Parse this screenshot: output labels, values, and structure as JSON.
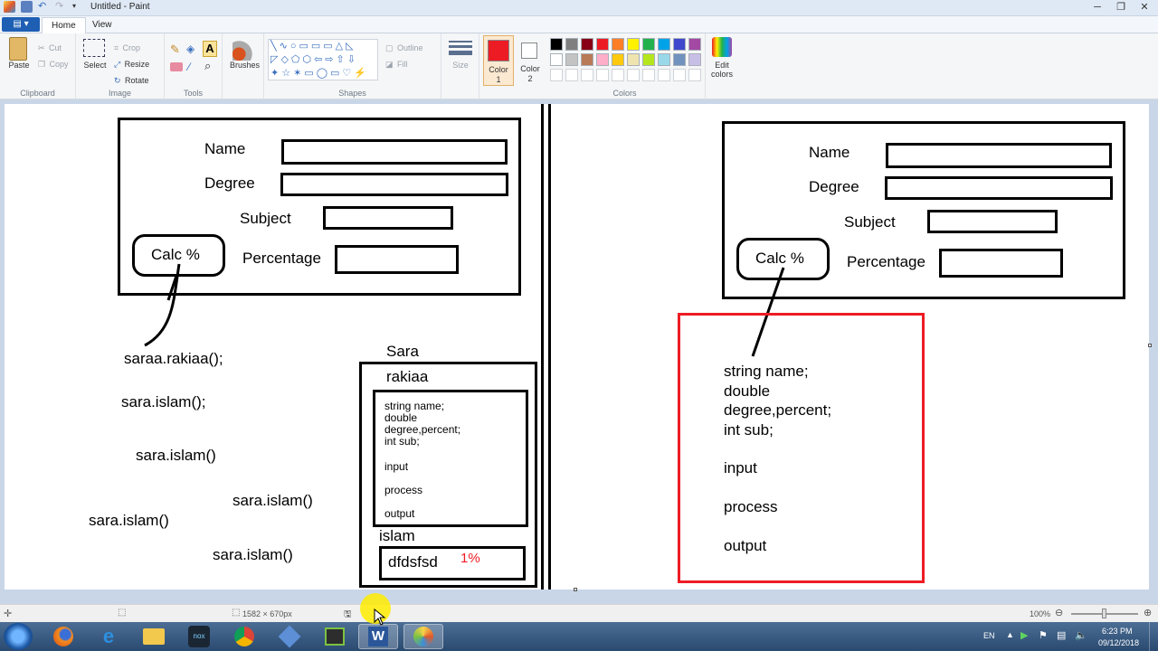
{
  "window": {
    "title": "Untitled - Paint"
  },
  "tabs": {
    "file": "▤ ▾",
    "home": "Home",
    "view": "View"
  },
  "ribbon": {
    "clipboard": {
      "paste": "Paste",
      "cut": "Cut",
      "copy": "Copy",
      "label": "Clipboard"
    },
    "image": {
      "select": "Select",
      "crop": "Crop",
      "resize": "Resize",
      "rotate": "Rotate",
      "label": "Image"
    },
    "tools": {
      "label": "Tools"
    },
    "brushes": {
      "label": "Brushes"
    },
    "shapes": {
      "outline": "Outline",
      "fill": "Fill",
      "label": "Shapes"
    },
    "size": {
      "label": "Size"
    },
    "color1": {
      "line1": "Color",
      "line2": "1",
      "value": "#ed1c24"
    },
    "color2": {
      "line1": "Color",
      "line2": "2",
      "value": "#ffffff"
    },
    "colors": {
      "label": "Colors",
      "row1": [
        "#000000",
        "#7f7f7f",
        "#880015",
        "#ed1c24",
        "#ff7f27",
        "#fff200",
        "#22b14c",
        "#00a2e8",
        "#3f48cc",
        "#a349a4"
      ],
      "row2": [
        "#ffffff",
        "#c3c3c3",
        "#b97a57",
        "#ffaec9",
        "#ffc90e",
        "#efe4b0",
        "#b5e61d",
        "#99d9ea",
        "#7092be",
        "#c8bfe7"
      ]
    },
    "edit_colors": {
      "line1": "Edit",
      "line2": "colors"
    }
  },
  "left_form": {
    "name": "Name",
    "degree": "Degree",
    "subject": "Subject",
    "calc": "Calc %",
    "percentage": "Percentage"
  },
  "left_calls": {
    "c1": "saraa.rakiaa();",
    "c2": "sara.islam();",
    "c3": "sara.islam()",
    "c4": "sara.islam()",
    "c5": "sara.islam()",
    "c6": "sara.islam()"
  },
  "object_box": {
    "sara": "Sara",
    "rakiaa": "rakiaa",
    "code": [
      "string name;",
      "double",
      "degree,percent;",
      "int sub;"
    ],
    "input": "input",
    "process": "process",
    "output": "output",
    "islam": "islam",
    "value": "dfdsfsd",
    "percent": "1%"
  },
  "right_form": {
    "name": "Name",
    "degree": "Degree",
    "subject": "Subject",
    "calc": "Calc %",
    "percentage": "Percentage"
  },
  "right_code": {
    "lines": [
      "string name;",
      "double",
      "degree,percent;",
      "int sub;"
    ],
    "input": "input",
    "process": "process",
    "output": "output"
  },
  "statusbar": {
    "dimensions": "1582 × 670px",
    "zoom": "100%"
  },
  "tray": {
    "lang": "EN",
    "time": "6:23 PM",
    "date": "09/12/2018"
  }
}
